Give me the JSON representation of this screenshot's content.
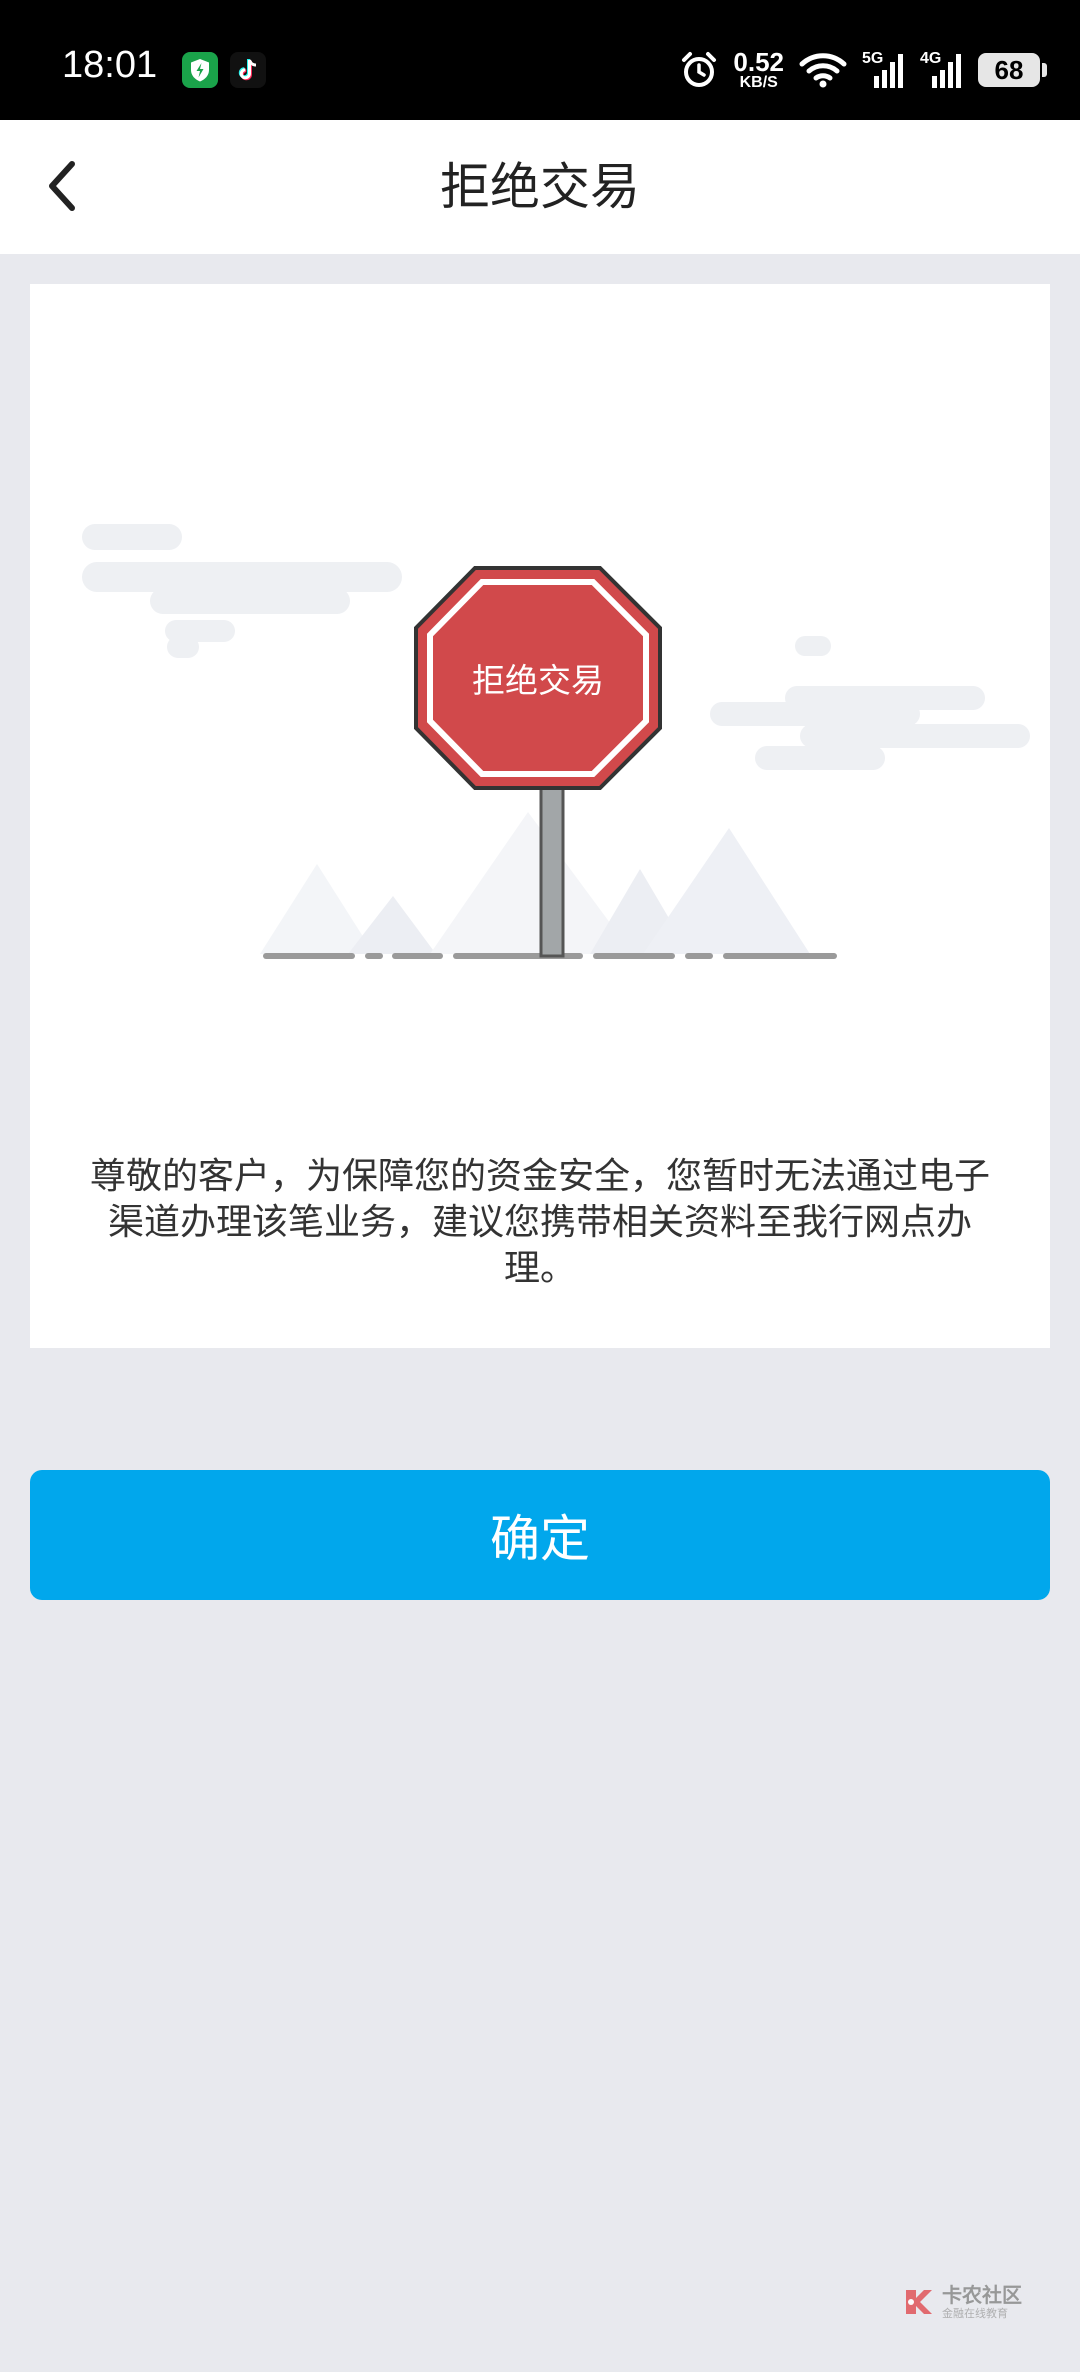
{
  "status_bar": {
    "time": "18:01",
    "net_speed_value": "0.52",
    "net_speed_unit": "KB/S",
    "signal_1_label": "5G",
    "signal_2_label": "4G",
    "battery_level": "68"
  },
  "header": {
    "title": "拒绝交易"
  },
  "illustration": {
    "sign_text": "拒绝交易",
    "sign_color": "#d1494b"
  },
  "message": {
    "text": "尊敬的客户，为保障您的资金安全，您暂时无法通过电子渠道办理该笔业务，建议您携带相关资料至我行网点办理。"
  },
  "actions": {
    "confirm_label": "确定",
    "confirm_color": "#01a7ec"
  },
  "watermark": {
    "main": "卡农社区",
    "sub": "金融在线教育"
  }
}
